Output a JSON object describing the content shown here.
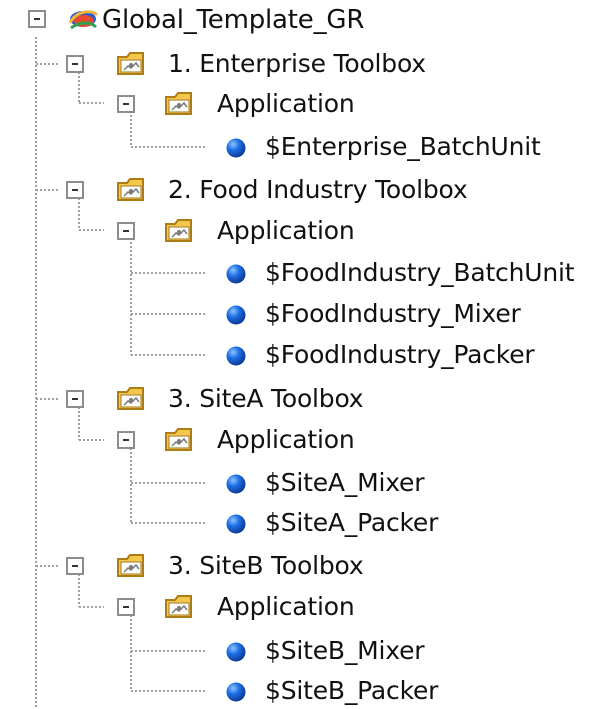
{
  "tree": {
    "root": {
      "label": "Global_Template_GR",
      "icon": "cube-icon"
    },
    "toolboxes": [
      {
        "label": "1. Enterprise Toolbox",
        "icon": "folder-icon",
        "application": {
          "label": "Application",
          "icon": "folder-icon",
          "items": [
            {
              "label": "$Enterprise_BatchUnit",
              "icon": "object-icon"
            }
          ]
        }
      },
      {
        "label": "2. Food Industry Toolbox",
        "icon": "folder-icon",
        "application": {
          "label": "Application",
          "icon": "folder-icon",
          "items": [
            {
              "label": "$FoodIndustry_BatchUnit",
              "icon": "object-icon"
            },
            {
              "label": "$FoodIndustry_Mixer",
              "icon": "object-icon"
            },
            {
              "label": "$FoodIndustry_Packer",
              "icon": "object-icon"
            }
          ]
        }
      },
      {
        "label": "3. SiteA Toolbox",
        "icon": "folder-icon",
        "application": {
          "label": "Application",
          "icon": "folder-icon",
          "items": [
            {
              "label": "$SiteA_Mixer",
              "icon": "object-icon"
            },
            {
              "label": "$SiteA_Packer",
              "icon": "object-icon"
            }
          ]
        }
      },
      {
        "label": "3. SiteB Toolbox",
        "icon": "folder-icon",
        "application": {
          "label": "Application",
          "icon": "folder-icon",
          "items": [
            {
              "label": "$SiteB_Mixer",
              "icon": "object-icon"
            },
            {
              "label": "$SiteB_Packer",
              "icon": "object-icon"
            }
          ]
        }
      }
    ]
  },
  "colors": {
    "background": "#ffffff",
    "text": "#111111",
    "tree_lines": "#9aa0a6",
    "folder": "#f0c040",
    "object_blue": "#1f6fe5"
  }
}
